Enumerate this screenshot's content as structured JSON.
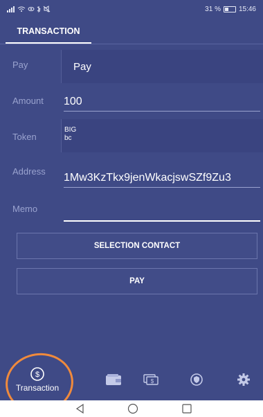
{
  "status_bar": {
    "left_icons": "signal wifi eye bluetooth mute",
    "battery_percent": "31 %",
    "time": "15:46"
  },
  "tabs": [
    {
      "label": "TRANSACTION",
      "active": true
    }
  ],
  "form": {
    "pay": {
      "label": "Pay",
      "value": "Pay"
    },
    "amount": {
      "label": "Amount",
      "value": "100"
    },
    "token": {
      "label": "Token",
      "value_line1": "BIG",
      "value_line2": "bc"
    },
    "address": {
      "label": "Address",
      "value": "1Mw3KzTkx9jenWkacjswSZf9Zu3"
    },
    "memo": {
      "label": "Memo",
      "value": ""
    }
  },
  "buttons": {
    "selection_contact": "SELECTION CONTACT",
    "pay": "PAY"
  },
  "bottom_nav": {
    "items": [
      {
        "label": "Transaction",
        "icon": "dollar-circle-icon",
        "active": true
      },
      {
        "label": "",
        "icon": "wallet-icon"
      },
      {
        "label": "",
        "icon": "money-exchange-icon"
      },
      {
        "label": "",
        "icon": "shield-icon"
      },
      {
        "label": "",
        "icon": "gear-icon"
      }
    ]
  },
  "colors": {
    "background": "#3f4a86",
    "highlight": "#f08a3c"
  }
}
